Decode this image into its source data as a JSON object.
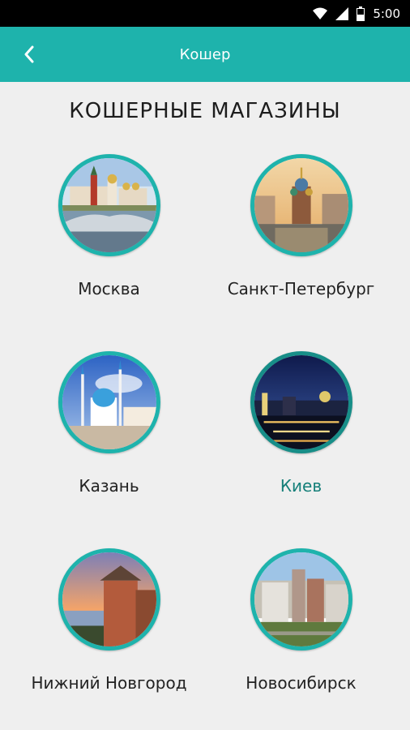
{
  "status_bar": {
    "time": "5:00"
  },
  "app_bar": {
    "title": "Кошер"
  },
  "heading": "КОШЕРНЫЕ МАГАЗИНЫ",
  "colors": {
    "accent": "#1eb3ac",
    "active_text": "#157f79",
    "background": "#efefef"
  },
  "cities": [
    {
      "label": "Москва",
      "icon": "moscow-kremlin-photo"
    },
    {
      "label": "Санкт-Петербург",
      "icon": "spb-church-photo"
    },
    {
      "label": "Казань",
      "icon": "kazan-mosque-photo"
    },
    {
      "label": "Киев",
      "icon": "kiev-night-photo",
      "active": true
    },
    {
      "label": "Нижний Новгород",
      "icon": "nizhny-tower-photo"
    },
    {
      "label": "Новосибирск",
      "icon": "novosibirsk-city-photo"
    }
  ]
}
